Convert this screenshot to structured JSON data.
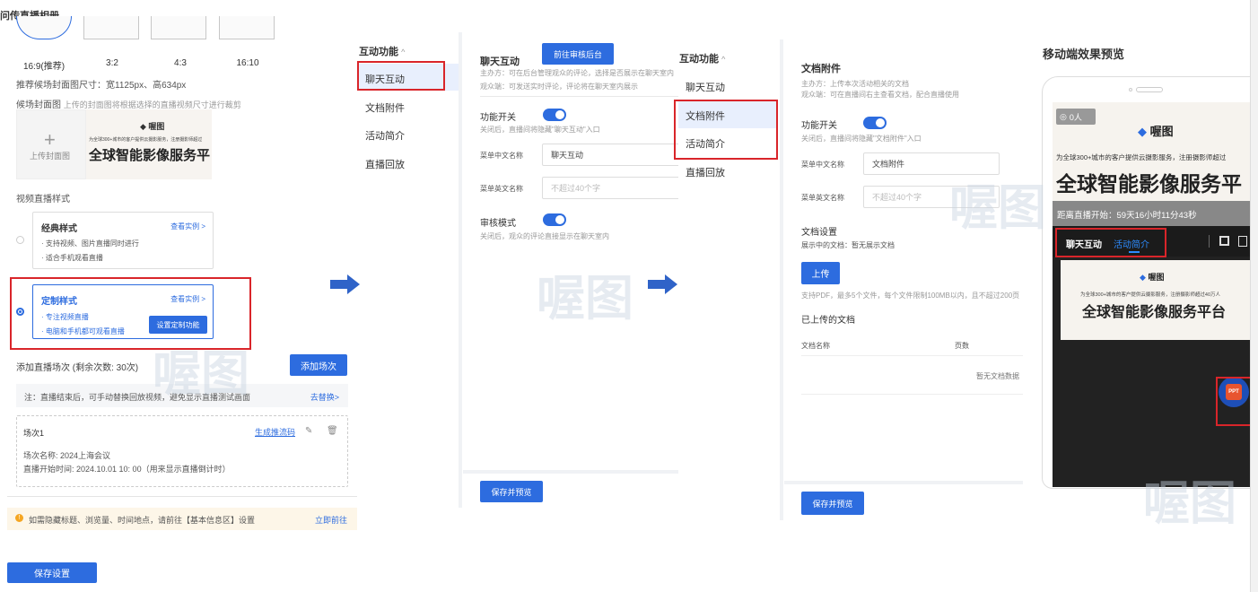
{
  "panel1": {
    "title": "问传直播相册",
    "ratios": [
      "16:9(推荐)",
      "3:2",
      "4:3",
      "16:10"
    ],
    "recommend_size": "推荐候场封面图尺寸：宽1125px、高634px",
    "cover_label": "候场封面图",
    "cover_hint": "上传的封面图将根据选择的直播视频尺寸进行裁剪",
    "upload_label": "上传封面图",
    "cover_brand": "喔图",
    "cover_small": "为全球300+城市的客户提供云摄影服务，注册摄影师超过",
    "cover_big": "全球智能影像服务平",
    "style_section": "视频直播样式",
    "classic": {
      "title": "经典样式",
      "link": "查看实例 >",
      "line1": "· 支持视频、图片直播同时进行",
      "line2": "· 适合手机观看直播"
    },
    "custom": {
      "title": "定制样式",
      "link": "查看实例 >",
      "line1": "· 专注视频直播",
      "line2": "· 电脑和手机都可观看直播",
      "button": "设置定制功能"
    },
    "add_session_label": "添加直播场次 (剩余次数: 30次)",
    "add_session_button": "添加场次",
    "note": "注：直播结束后，可手动替换回放视频，避免显示直播测试画面",
    "note_link": "去替换>",
    "session": {
      "title": "场次1",
      "link": "生成推流码",
      "name": "场次名称: 2024上海会议",
      "start": "直播开始时间: 2024.10.01 10: 00（用来显示直播倒计时）"
    },
    "banner_text": "如需隐藏标题、浏览量、时间地点，请前往【基本信息区】设置",
    "banner_link": "立即前往",
    "save_button": "保存设置"
  },
  "panel2": {
    "nav_title": "互动功能",
    "nav_items": [
      "聊天互动",
      "文档附件",
      "活动简介",
      "直播回放"
    ],
    "section_title": "聊天互动",
    "audit_button": "前往审核后台",
    "desc1": "主办方：可在后台管理观众的评论，选择是否展示在聊天室内",
    "desc2": "观众端：可发送实时评论，评论将在聊天室内展示",
    "switch_label": "功能开关",
    "switch_hint": "关闭后，直播间将隐藏\"聊天互动\"入口",
    "cn_label": "菜单中文名称",
    "cn_value": "聊天互动",
    "en_label": "菜单英文名称",
    "en_placeholder": "不超过40个字",
    "audit_label": "审核模式",
    "audit_hint": "关闭后，观众的评论直接显示在聊天室内",
    "save_button": "保存并预览"
  },
  "panel3": {
    "nav_title": "互动功能",
    "nav_items": [
      "聊天互动",
      "文档附件",
      "活动简介",
      "直播回放"
    ],
    "section_title": "文档附件",
    "desc1": "主办方：上传本次活动相关的文档",
    "desc2": "观众端：可在直播间右主查看文档，配合直播使用",
    "switch_label": "功能开关",
    "switch_hint": "关闭后，直播间将隐藏\"文档附件\"入口",
    "cn_label": "菜单中文名称",
    "cn_value": "文档附件",
    "en_label": "菜单英文名称",
    "en_placeholder": "不超过40个字",
    "doc_settings": "文档设置",
    "doc_showing": "展示中的文档：暂无展示文档",
    "upload_button": "上传",
    "upload_hint": "支持PDF，最多5个文件，每个文件限制100MB以内，且不超过200页",
    "uploaded_title": "已上传的文档",
    "col_name": "文档名称",
    "col_pages": "页数",
    "empty": "暂无文档数据",
    "save_button": "保存并预览"
  },
  "panel4": {
    "title": "移动端效果预览",
    "viewers": "0人",
    "brand": "喔图",
    "slogan_small": "为全球300+城市的客户提供云摄影服务，注册摄影师超过",
    "slogan_big": "全球智能影像服务平",
    "countdown": "距离直播开始：59天16小时11分43秒",
    "tab1": "聊天互动",
    "tab2": "活动简介",
    "inner_brand": "喔图",
    "inner_small": "为全球300+城市的客户提供云摄影服务，注册摄影师超过40万人",
    "inner_big": "全球智能影像服务平台",
    "ppt": "PPT"
  },
  "watermark": "喔图",
  "colors": {
    "accent": "#2d6cdf",
    "highlight": "#d9252a"
  }
}
